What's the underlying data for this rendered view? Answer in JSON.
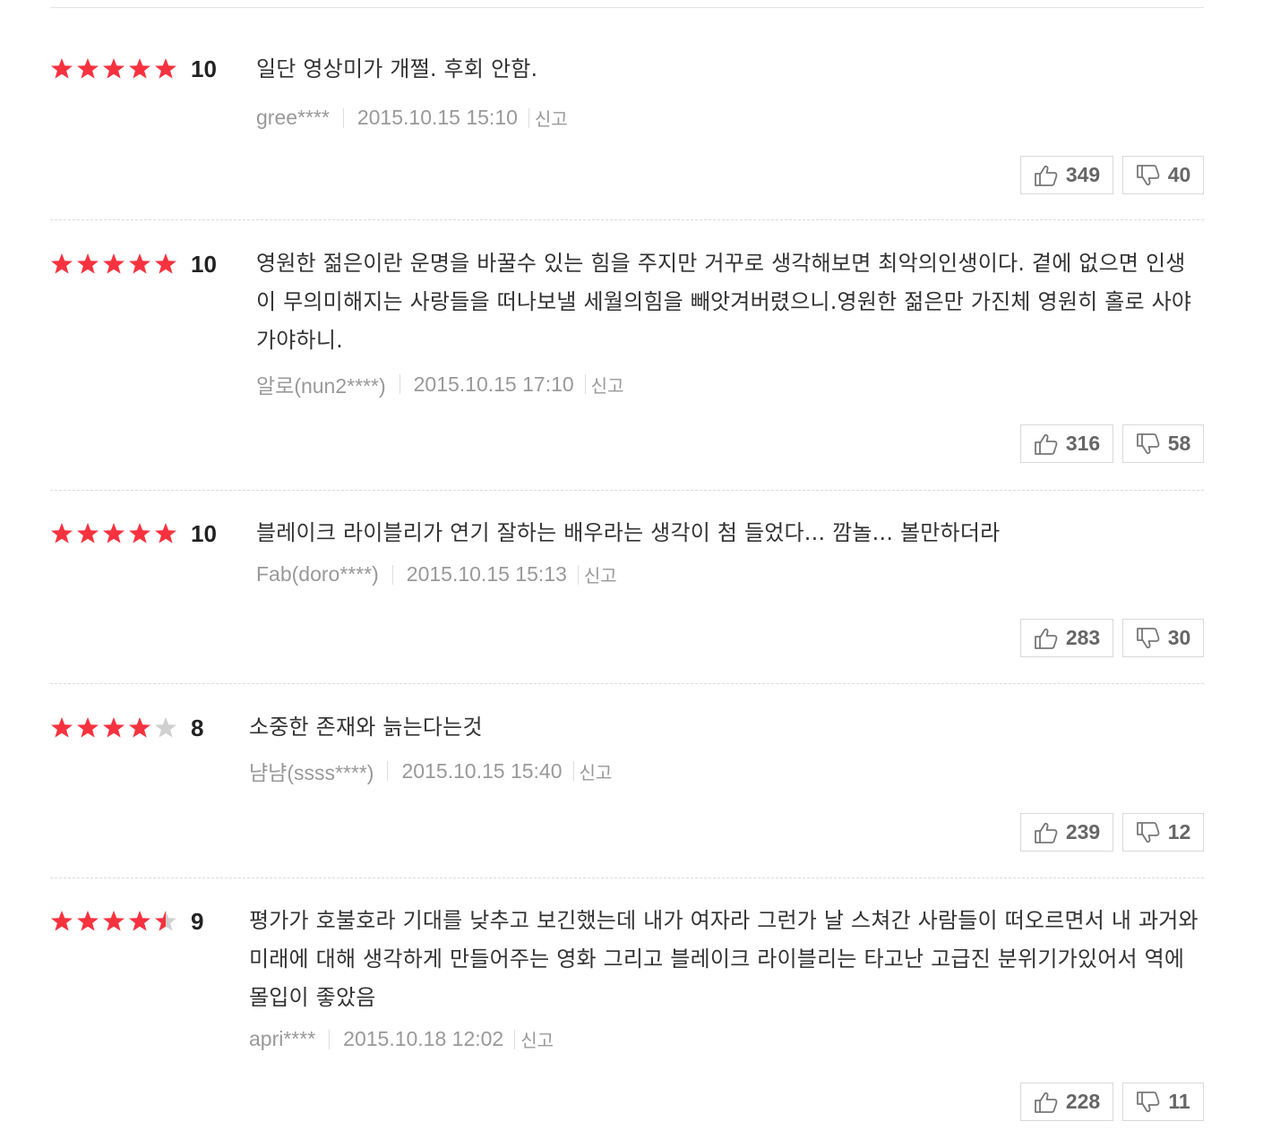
{
  "colors": {
    "star_on": "#f7323f",
    "star_off": "#d0d0d0",
    "text": "#333333",
    "meta": "#999999"
  },
  "reviews": [
    {
      "stars": 5,
      "score": "10",
      "text": "일단 영상미가 개쩔. 후회 안함.",
      "nick": "gree****",
      "date": "2015.10.15 15:10",
      "report": "신고",
      "likes": "349",
      "dislikes": "40"
    },
    {
      "stars": 5,
      "score": "10",
      "text": "영원한 젊은이란 운명을 바꿀수 있는 힘을 주지만 거꾸로 생각해보면 최악의인생이다. 곁에 없으면 인생이 무의미해지는 사랑들을 떠나보낼 세월의힘을 빼앗겨버렸으니.영원한 젊은만 가진체 영원히 홀로 사야가야하니.",
      "nick": "알로(nun2****)",
      "date": "2015.10.15 17:10",
      "report": "신고",
      "likes": "316",
      "dislikes": "58"
    },
    {
      "stars": 5,
      "score": "10",
      "text": "블레이크 라이블리가 연기 잘하는 배우라는 생각이 첨 들었다... 깜놀... 볼만하더라",
      "nick": "Fab(doro****)",
      "date": "2015.10.15 15:13",
      "report": "신고",
      "likes": "283",
      "dislikes": "30"
    },
    {
      "stars": 4,
      "score": "8",
      "text": "소중한 존재와 늙는다는것",
      "nick": "냠냠(ssss****)",
      "date": "2015.10.15 15:40",
      "report": "신고",
      "likes": "239",
      "dislikes": "12"
    },
    {
      "stars": 4.5,
      "score": "9",
      "text": "평가가 호불호라 기대를 낮추고 보긴했는데 내가 여자라 그런가 날 스쳐간 사람들이 떠오르면서 내 과거와 미래에 대해 생각하게 만들어주는 영화 그리고 블레이크 라이블리는 타고난 고급진 분위기가있어서 역에 몰입이 좋았음",
      "nick": "apri****",
      "date": "2015.10.18 12:02",
      "report": "신고",
      "likes": "228",
      "dislikes": "11"
    }
  ]
}
